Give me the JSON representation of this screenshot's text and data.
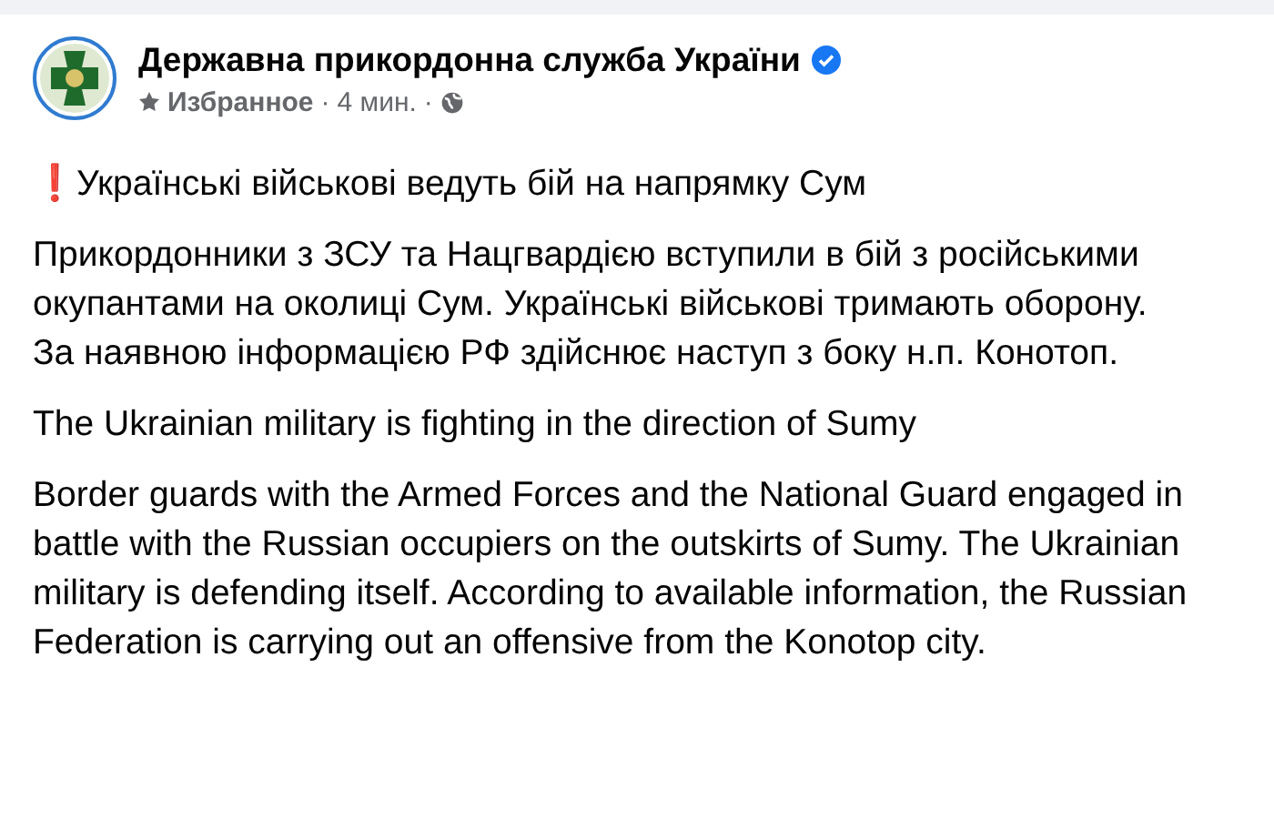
{
  "post": {
    "author": "Державна прикордонна служба України",
    "verified": true,
    "meta": [
      "Избранное",
      "·",
      "4 мин.",
      "·"
    ],
    "paragraphs": [
      "❗Українські військові ведуть бій на напрямку Сум",
      "Прикордонники з ЗСУ та Нацгвардією вступили в бій з російськими окупантами на околиці Сум. Українські військові тримають оборону. За наявною інформацією РФ здійснює наступ з боку н.п. Конотоп.",
      "The Ukrainian military is fighting in the direction of Sumy",
      "Border guards with the Armed Forces and the National Guard engaged in battle with the Russian occupiers on the outskirts of Sumy. The Ukrainian military is defending itself. According to available information, the Russian Federation is carrying out an offensive from the Konotop city."
    ]
  }
}
